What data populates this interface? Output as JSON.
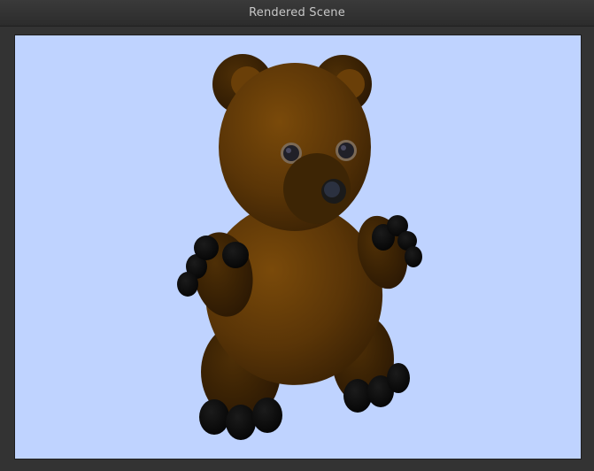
{
  "window": {
    "title": "Rendered Scene"
  },
  "scene": {
    "background_color": "#bfd3ff",
    "fur_color": "#5a3507",
    "dark_color": "#111111",
    "nose_color": "#2a2a2a"
  }
}
